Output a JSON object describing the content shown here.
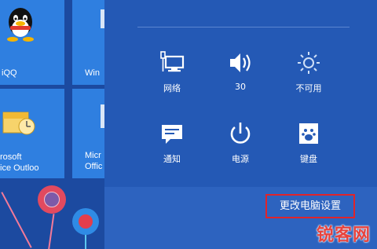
{
  "start_tiles": {
    "qq_label": "iQQ",
    "win_label": "Win",
    "outlook_label": "rosoft\nice Outloo",
    "office_label": "Micr\nOffic"
  },
  "quick_settings": [
    {
      "label": "网络",
      "icon": "network-icon"
    },
    {
      "label": "30",
      "icon": "volume-icon"
    },
    {
      "label": "不可用",
      "icon": "brightness-icon"
    },
    {
      "label": "通知",
      "icon": "notifications-icon"
    },
    {
      "label": "电源",
      "icon": "power-icon"
    },
    {
      "label": "键盘",
      "icon": "keyboard-icon"
    }
  ],
  "change_pc_settings_label": "更改电脑设置",
  "watermark_text": "锐客网",
  "colors": {
    "panel_bg": "#2459b5",
    "tile_bg": "#2f7fe0",
    "highlight_border": "#e0242a"
  }
}
